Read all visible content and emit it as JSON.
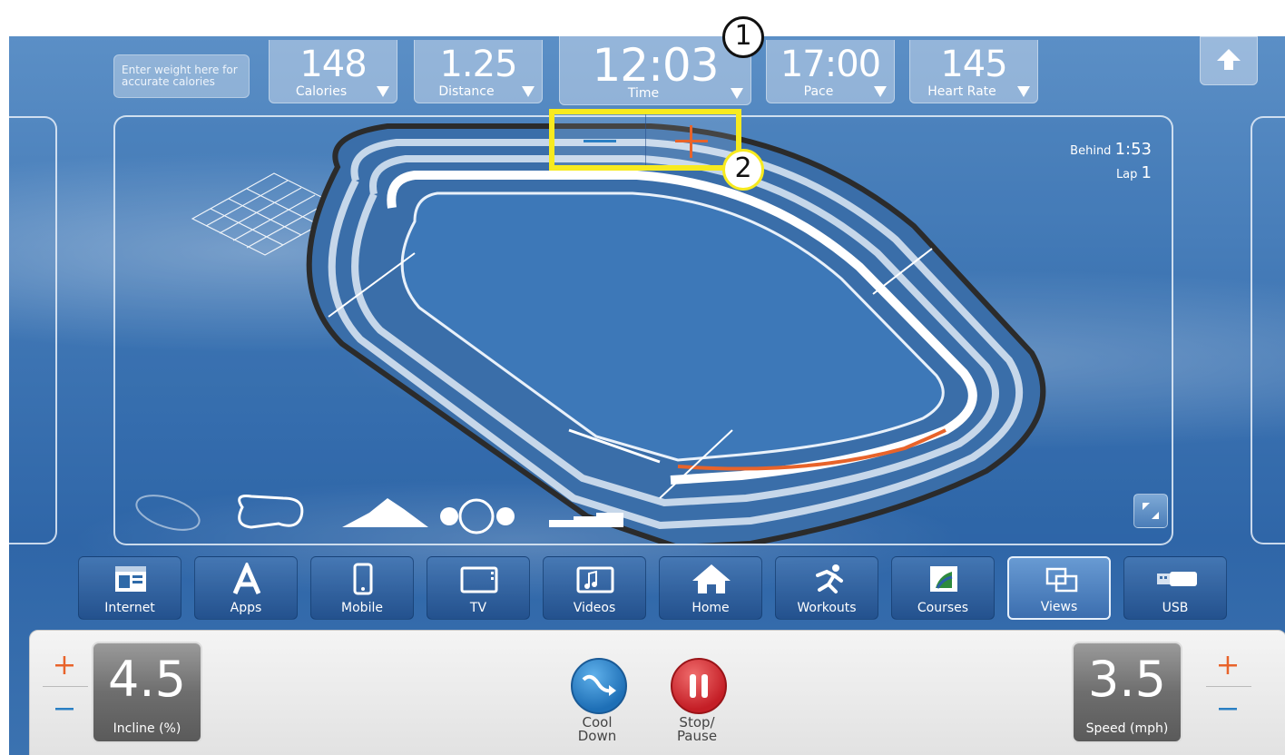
{
  "callouts": {
    "one": "1",
    "two": "2"
  },
  "weight_prompt": "Enter weight here for accurate calories",
  "stats": [
    {
      "value": "148",
      "label": "Calories"
    },
    {
      "value": "1.25",
      "label": "Distance"
    },
    {
      "value": "12:03",
      "label": "Time"
    },
    {
      "value": "17:00",
      "label": "Pace"
    },
    {
      "value": "145",
      "label": "Heart Rate"
    }
  ],
  "track_info": {
    "behind_label": "Behind",
    "behind_value": "1:53",
    "lap_label": "Lap",
    "lap_value": "1"
  },
  "nav": [
    {
      "label": "Internet",
      "icon": "browser-icon"
    },
    {
      "label": "Apps",
      "icon": "apps-icon"
    },
    {
      "label": "Mobile",
      "icon": "phone-icon"
    },
    {
      "label": "TV",
      "icon": "tv-icon"
    },
    {
      "label": "Videos",
      "icon": "video-icon"
    },
    {
      "label": "Home",
      "icon": "home-icon"
    },
    {
      "label": "Workouts",
      "icon": "runner-icon"
    },
    {
      "label": "Courses",
      "icon": "courses-icon"
    },
    {
      "label": "Views",
      "icon": "views-icon",
      "active": true
    },
    {
      "label": "USB",
      "icon": "usb-icon"
    }
  ],
  "incline": {
    "value": "4.5",
    "label": "Incline (%)"
  },
  "speed": {
    "value": "3.5",
    "label": "Speed (mph)"
  },
  "cool_down": {
    "line1": "Cool",
    "line2": "Down"
  },
  "stop_pause": {
    "line1": "Stop/",
    "line2": "Pause"
  },
  "colors": {
    "highlight": "#f7ea1f",
    "plus": "#e8632a",
    "minus": "#2a7fc4",
    "progress": "#e8632a"
  }
}
